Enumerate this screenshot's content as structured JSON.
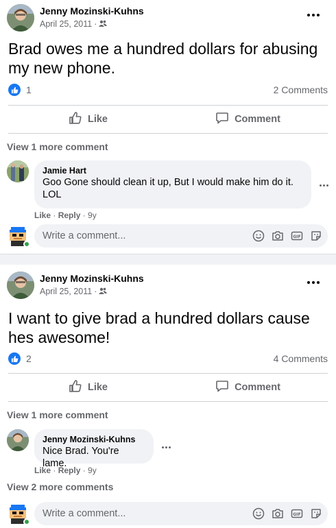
{
  "colors": {
    "accent": "#1877f2",
    "muted": "#65676b",
    "online": "#31a24c"
  },
  "posts": [
    {
      "author": "Jenny Mozinski-Kuhns",
      "date": "April 25, 2011",
      "audience_icon": "friends-icon",
      "text": "Brad owes me a hundred dollars for abusing my new phone.",
      "likes": "1",
      "comments_count": "2 Comments",
      "like_label": "Like",
      "comment_label": "Comment",
      "view_more": "View 1 more comment",
      "comment": {
        "author": "Jamie Hart",
        "text": "Goo Gone should clean it up, But I would make him do it. LOL",
        "like": "Like",
        "reply": "Reply",
        "age": "9y"
      },
      "write_placeholder": "Write a comment..."
    },
    {
      "author": "Jenny Mozinski-Kuhns",
      "date": "April 25, 2011",
      "audience_icon": "friends-icon",
      "text": "I want to give brad a hundred dollars cause hes awesome!",
      "likes": "2",
      "comments_count": "4 Comments",
      "like_label": "Like",
      "comment_label": "Comment",
      "view_more": "View 1 more comment",
      "comment": {
        "author": "Jenny Mozinski-Kuhns",
        "text": "Nice Brad. You're lame.",
        "like": "Like",
        "reply": "Reply",
        "age": "9y"
      },
      "view_more_after": "View 2 more comments",
      "write_placeholder": "Write a comment..."
    }
  ]
}
